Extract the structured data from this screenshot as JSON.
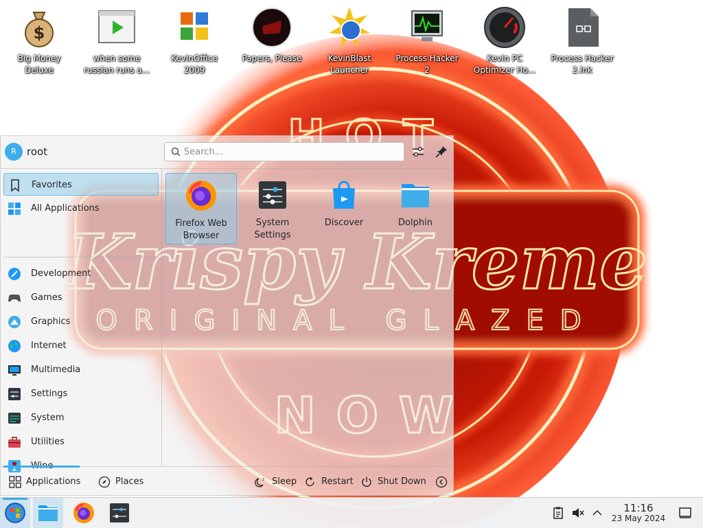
{
  "desktop": {
    "icons": [
      {
        "label": "Big Money\nDeluxe",
        "icon": "money-bag-icon"
      },
      {
        "label": "when some\nrussian runs a...",
        "icon": "video-player-icon"
      },
      {
        "label": "KevinOffice\n2009",
        "icon": "office-suite-icon"
      },
      {
        "label": "Papers, Please",
        "icon": "papers-please-icon"
      },
      {
        "label": "KevinBlast\nLauncher",
        "icon": "kevinblast-icon"
      },
      {
        "label": "Process Hacker\n2",
        "icon": "process-monitor-icon"
      },
      {
        "label": "Kevin PC\nOptimizer Ho...",
        "icon": "gauge-icon"
      },
      {
        "label": "Process Hacker\n2.lnk",
        "icon": "shortcut-file-icon"
      }
    ]
  },
  "launcher": {
    "user": {
      "initial": "R",
      "name": "root"
    },
    "search": {
      "placeholder": "Search..."
    },
    "categories": [
      {
        "label": "Favorites",
        "icon": "bookmark-icon",
        "active": true
      },
      {
        "label": "All Applications",
        "icon": "all-apps-icon"
      },
      {
        "label": "Development",
        "icon": "development-icon"
      },
      {
        "label": "Games",
        "icon": "gamepad-icon"
      },
      {
        "label": "Graphics",
        "icon": "graphics-icon"
      },
      {
        "label": "Internet",
        "icon": "globe-icon"
      },
      {
        "label": "Multimedia",
        "icon": "multimedia-icon"
      },
      {
        "label": "Settings",
        "icon": "settings-icon"
      },
      {
        "label": "System",
        "icon": "system-icon"
      },
      {
        "label": "Utilities",
        "icon": "toolbox-icon"
      },
      {
        "label": "Wine",
        "icon": "wine-icon"
      }
    ],
    "favorites": [
      {
        "label": "Firefox Web\nBrowser",
        "icon": "firefox-icon",
        "selected": true
      },
      {
        "label": "System\nSettings",
        "icon": "system-settings-icon"
      },
      {
        "label": "Discover",
        "icon": "discover-icon"
      },
      {
        "label": "Dolphin",
        "icon": "folder-icon"
      }
    ],
    "footer": {
      "applications": "Applications",
      "places": "Places",
      "sleep": "Sleep",
      "restart": "Restart",
      "shutdown": "Shut Down"
    }
  },
  "taskbar": {
    "clock": {
      "time": "11:16",
      "date": "23 May 2024"
    }
  },
  "colors": {
    "accent": "#3daee9",
    "neon": "#ff2a10"
  }
}
